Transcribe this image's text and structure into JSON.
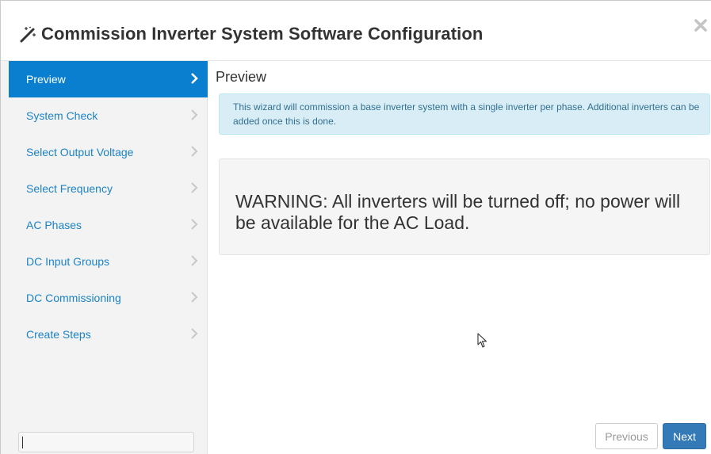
{
  "header": {
    "title": "Commission Inverter System Software Configuration",
    "title_icon": "magic-wand-icon",
    "close_icon": "close-icon"
  },
  "sidebar": {
    "items": [
      {
        "label": "Preview",
        "active": true
      },
      {
        "label": "System Check",
        "active": false
      },
      {
        "label": "Select Output Voltage",
        "active": false
      },
      {
        "label": "Select Frequency",
        "active": false
      },
      {
        "label": "AC Phases",
        "active": false
      },
      {
        "label": "DC Input Groups",
        "active": false
      },
      {
        "label": "DC Commissioning",
        "active": false
      },
      {
        "label": "Create Steps",
        "active": false
      }
    ],
    "input_value": ""
  },
  "main": {
    "title": "Preview",
    "info": "This wizard will commission a base inverter system with a single inverter per phase. Additional inverters can be added once this is done.",
    "warning": "WARNING: All inverters will be turned off; no power will be available for the AC Load."
  },
  "footer": {
    "previous_label": "Previous",
    "next_label": "Next"
  },
  "colors": {
    "active_nav": "#0a7fcf",
    "nav_link": "#1c83c6",
    "info_bg": "#d9edf7",
    "primary_button": "#337ab7"
  }
}
